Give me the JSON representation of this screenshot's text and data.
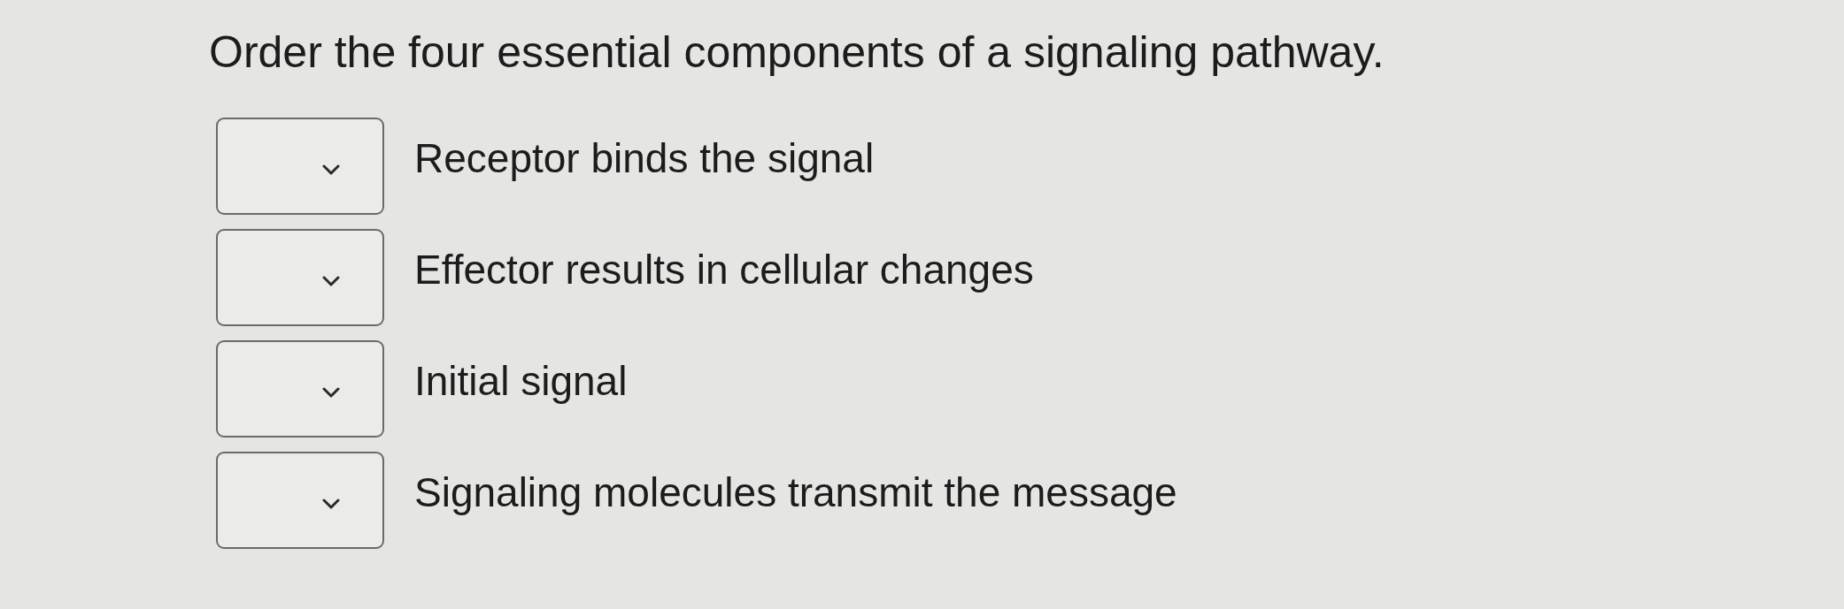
{
  "question": "Order the four essential components of a signaling pathway.",
  "items": [
    {
      "label": "Receptor binds the signal"
    },
    {
      "label": "Effector results in cellular changes"
    },
    {
      "label": "Initial signal"
    },
    {
      "label": "Signaling molecules transmit the message"
    }
  ]
}
